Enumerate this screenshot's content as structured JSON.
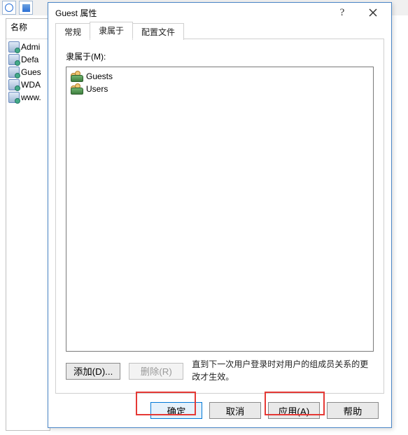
{
  "background": {
    "column_header": "名称",
    "items": [
      "Admi",
      "Defa",
      "Gues",
      "WDA",
      "www."
    ]
  },
  "dialog": {
    "title": "Guest 属性",
    "help_glyph": "?",
    "tabs": {
      "general": "常规",
      "member_of": "隶属于",
      "profile": "配置文件"
    },
    "member_of": {
      "label": "隶属于(M):",
      "groups": [
        "Guests",
        "Users"
      ],
      "add_label": "添加(D)...",
      "remove_label": "删除(R)",
      "hint": "直到下一次用户登录时对用户的组成员关系的更改才生效。"
    },
    "buttons": {
      "ok": "确定",
      "cancel": "取消",
      "apply": "应用(A)",
      "help": "帮助"
    }
  }
}
